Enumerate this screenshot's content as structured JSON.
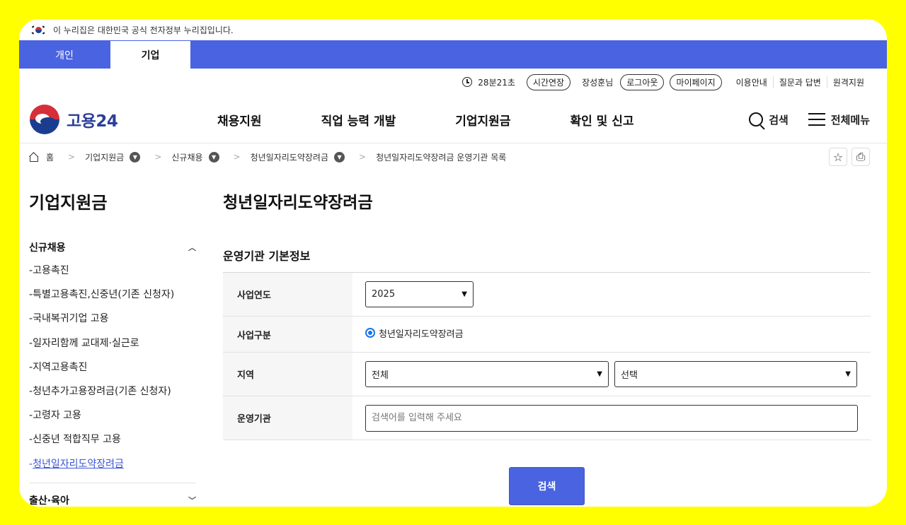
{
  "gov_banner": {
    "text": "이 누리집은 대한민국 공식 전자정부 누리집입니다."
  },
  "tabs": [
    {
      "label": "개인"
    },
    {
      "label": "기업"
    }
  ],
  "utility": {
    "timer": "28분21초",
    "extend": "시간연장",
    "username": "장성훈님",
    "logout": "로그아웃",
    "mypage": "마이페이지",
    "links": [
      "이용안내",
      "질문과 답변",
      "원격지원"
    ]
  },
  "logo": {
    "text": "고용24"
  },
  "gnb": {
    "menu": [
      "채용지원",
      "직업 능력 개발",
      "기업지원금",
      "확인 및 신고"
    ],
    "search": "검색",
    "all_menu": "전체메뉴"
  },
  "breadcrumb": {
    "home": "홈",
    "items": [
      "기업지원금",
      "신규채용",
      "청년일자리도약장려금",
      "청년일자리도약장려금 운영기관 목록"
    ]
  },
  "sidebar": {
    "title": "기업지원금",
    "group": "신규채용",
    "items": [
      "고용촉진",
      "특별고용촉진,신중년(기존 신청자)",
      "국내복귀기업 고용",
      "일자리함께 교대제·실근로",
      "지역고용촉진",
      "청년추가고용장려금(기존 신청자)",
      "고령자 고용",
      "신중년 적합직무 고용",
      "청년일자리도약장려금"
    ],
    "group2": "출산·육아"
  },
  "content": {
    "title": "청년일자리도약장려금",
    "section": "운영기관 기본정보",
    "fields": {
      "year": {
        "label": "사업연도",
        "value": "2025"
      },
      "type": {
        "label": "사업구분",
        "value": "청년일자리도약장려금"
      },
      "region": {
        "label": "지역",
        "value1": "전체",
        "value2": "선택"
      },
      "agency": {
        "label": "운영기관",
        "placeholder": "검색어를 입력해 주세요"
      }
    },
    "search_button": "검색"
  },
  "colors": {
    "brand_blue": "#4a63e0",
    "frame": "#ffff00",
    "active_link": "#3a55d6"
  }
}
